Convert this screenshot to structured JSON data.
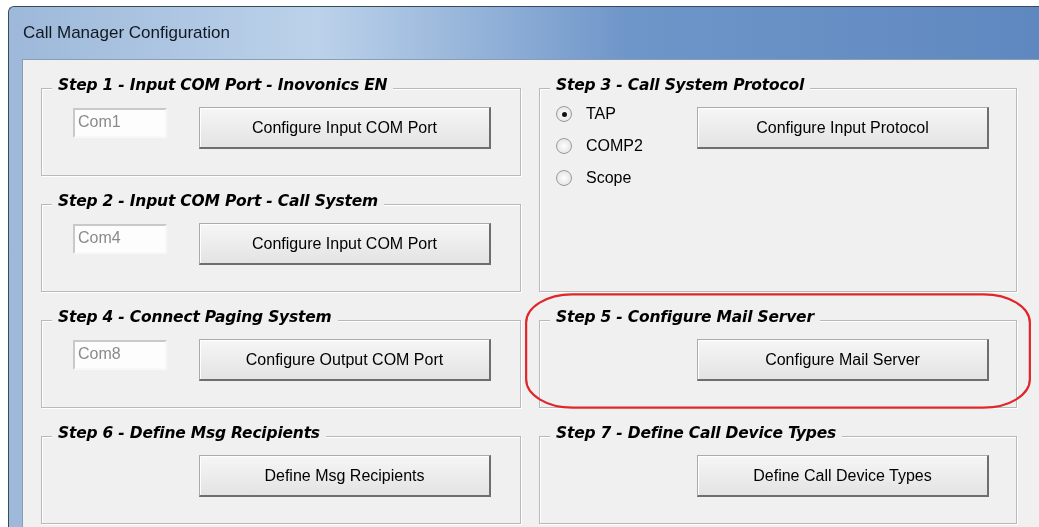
{
  "window": {
    "title": "Call Manager Configuration"
  },
  "groups": [
    {
      "kind": "port",
      "title": "Step 1 - Input COM Port - Inovonics EN",
      "tall": false,
      "highlighted": false,
      "field": {
        "value": "Com1",
        "disabled": true
      },
      "button": "Configure Input COM Port"
    },
    {
      "kind": "protocol",
      "title": "Step 3 - Call System Protocol",
      "tall": true,
      "highlighted": false,
      "options": [
        {
          "label": "TAP",
          "selected": true
        },
        {
          "label": "COMP2",
          "selected": false
        },
        {
          "label": "Scope",
          "selected": false
        }
      ],
      "button": "Configure Input Protocol"
    },
    {
      "kind": "port",
      "title": "Step 2 - Input COM Port - Call System",
      "tall": false,
      "highlighted": false,
      "field": {
        "value": "Com4",
        "disabled": true
      },
      "button": "Configure Input COM Port"
    },
    {
      "kind": "port",
      "title": "Step 4 - Connect Paging System",
      "tall": false,
      "highlighted": false,
      "field": {
        "value": "Com8",
        "disabled": true
      },
      "button": "Configure Output COM Port"
    },
    {
      "kind": "button",
      "title": "Step 5 - Configure Mail Server",
      "tall": false,
      "highlighted": true,
      "button": "Configure Mail Server"
    },
    {
      "kind": "button",
      "title": "Step 6 - Define Msg Recipients",
      "tall": false,
      "highlighted": false,
      "button": "Define Msg Recipients"
    },
    {
      "kind": "button",
      "title": "Step 7 - Define Call Device Types",
      "tall": false,
      "highlighted": false,
      "button": "Define Call Device Types"
    }
  ]
}
